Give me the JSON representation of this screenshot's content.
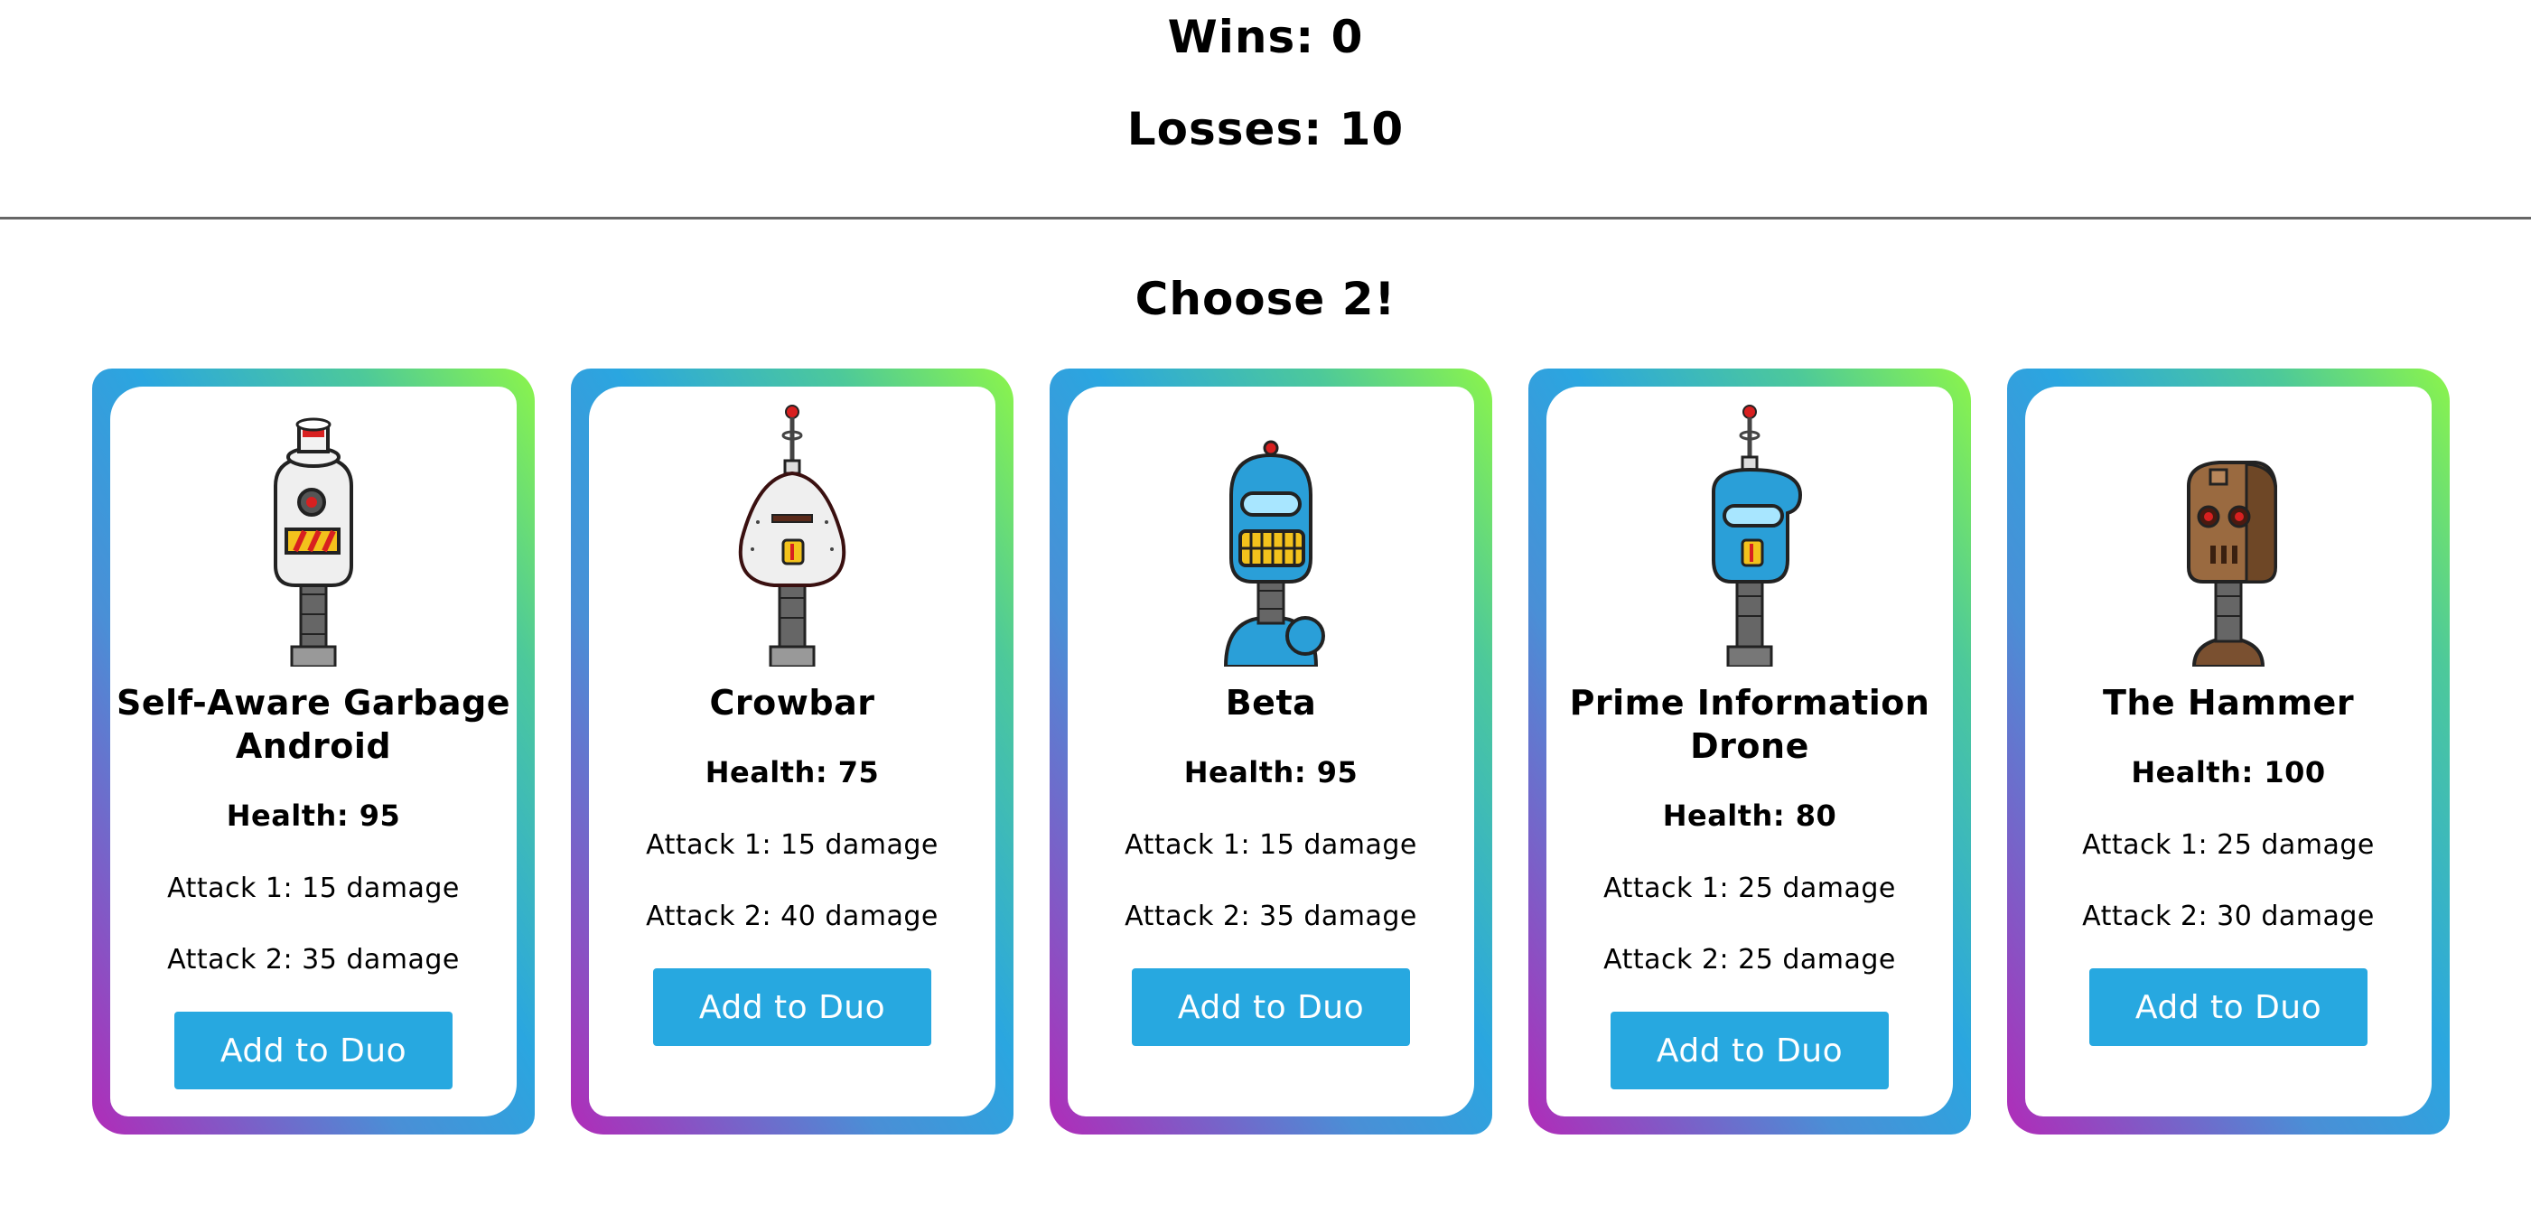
{
  "scoreboard": {
    "wins": "Wins: 0",
    "losses": "Losses: 10"
  },
  "heading": "Choose 2!",
  "cards": [
    {
      "name": "Self-Aware Garbage Android",
      "health": "Health: 95",
      "attack1": "Attack 1: 15 damage",
      "attack2": "Attack 2: 35 damage",
      "button": "Add to Duo",
      "icon": "white-robot-with-hat-icon"
    },
    {
      "name": "Crowbar",
      "health": "Health: 75",
      "attack1": "Attack 1: 15 damage",
      "attack2": "Attack 2: 40 damage",
      "button": "Add to Duo",
      "icon": "white-robot-with-antenna-icon"
    },
    {
      "name": "Beta",
      "health": "Health: 95",
      "attack1": "Attack 1: 15 damage",
      "attack2": "Attack 2: 35 damage",
      "button": "Add to Duo",
      "icon": "blue-robot-icon"
    },
    {
      "name": "Prime Information Drone",
      "health": "Health: 80",
      "attack1": "Attack 1: 25 damage",
      "attack2": "Attack 2: 25 damage",
      "button": "Add to Duo",
      "icon": "blue-robot-with-antenna-icon"
    },
    {
      "name": "The Hammer",
      "health": "Health: 100",
      "attack1": "Attack 1: 25 damage",
      "attack2": "Attack 2: 30 damage",
      "button": "Add to Duo",
      "icon": "brown-robot-icon"
    }
  ],
  "colors": {
    "button": "#27a8e0",
    "frame_gradient": [
      "#b12bb8",
      "#2aa6e0",
      "#8cf54a"
    ]
  }
}
